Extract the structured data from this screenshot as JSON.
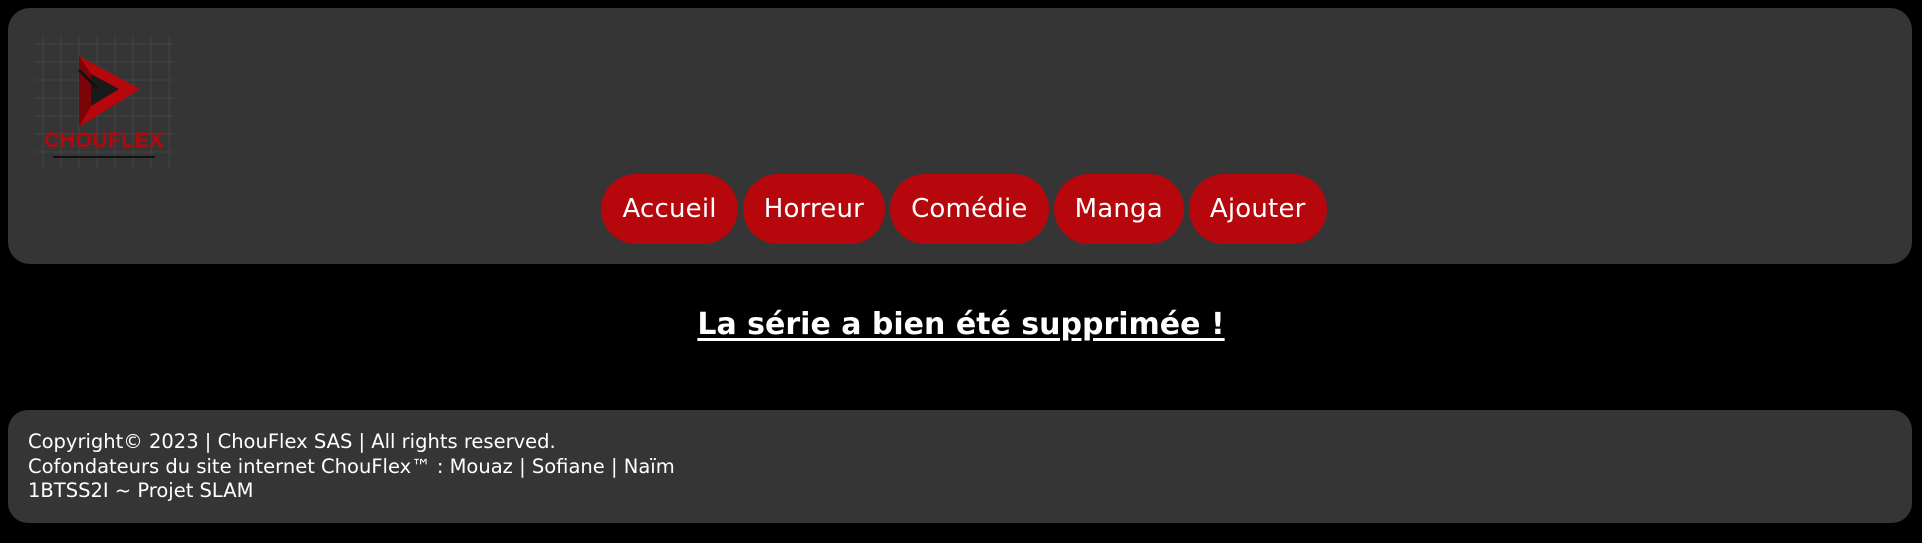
{
  "header": {
    "logo": {
      "text": "CHOUFLEX",
      "accent_color": "#b5070c"
    }
  },
  "nav": {
    "items": [
      {
        "label": "Accueil"
      },
      {
        "label": "Horreur"
      },
      {
        "label": "Comédie"
      },
      {
        "label": "Manga"
      },
      {
        "label": "Ajouter"
      }
    ]
  },
  "main": {
    "message": "La série a bien été supprimée !"
  },
  "footer": {
    "line1": "Copyright© 2023 | ChouFlex SAS | All rights reserved.",
    "line2": "Cofondateurs du site internet ChouFlex™ : Mouaz | Sofiane | Naïm",
    "line3": "1BTSS2I ~ Projet SLAM"
  },
  "colors": {
    "page_bg": "#000000",
    "panel_bg": "#353535",
    "accent": "#b5070c",
    "text": "#ffffff"
  }
}
